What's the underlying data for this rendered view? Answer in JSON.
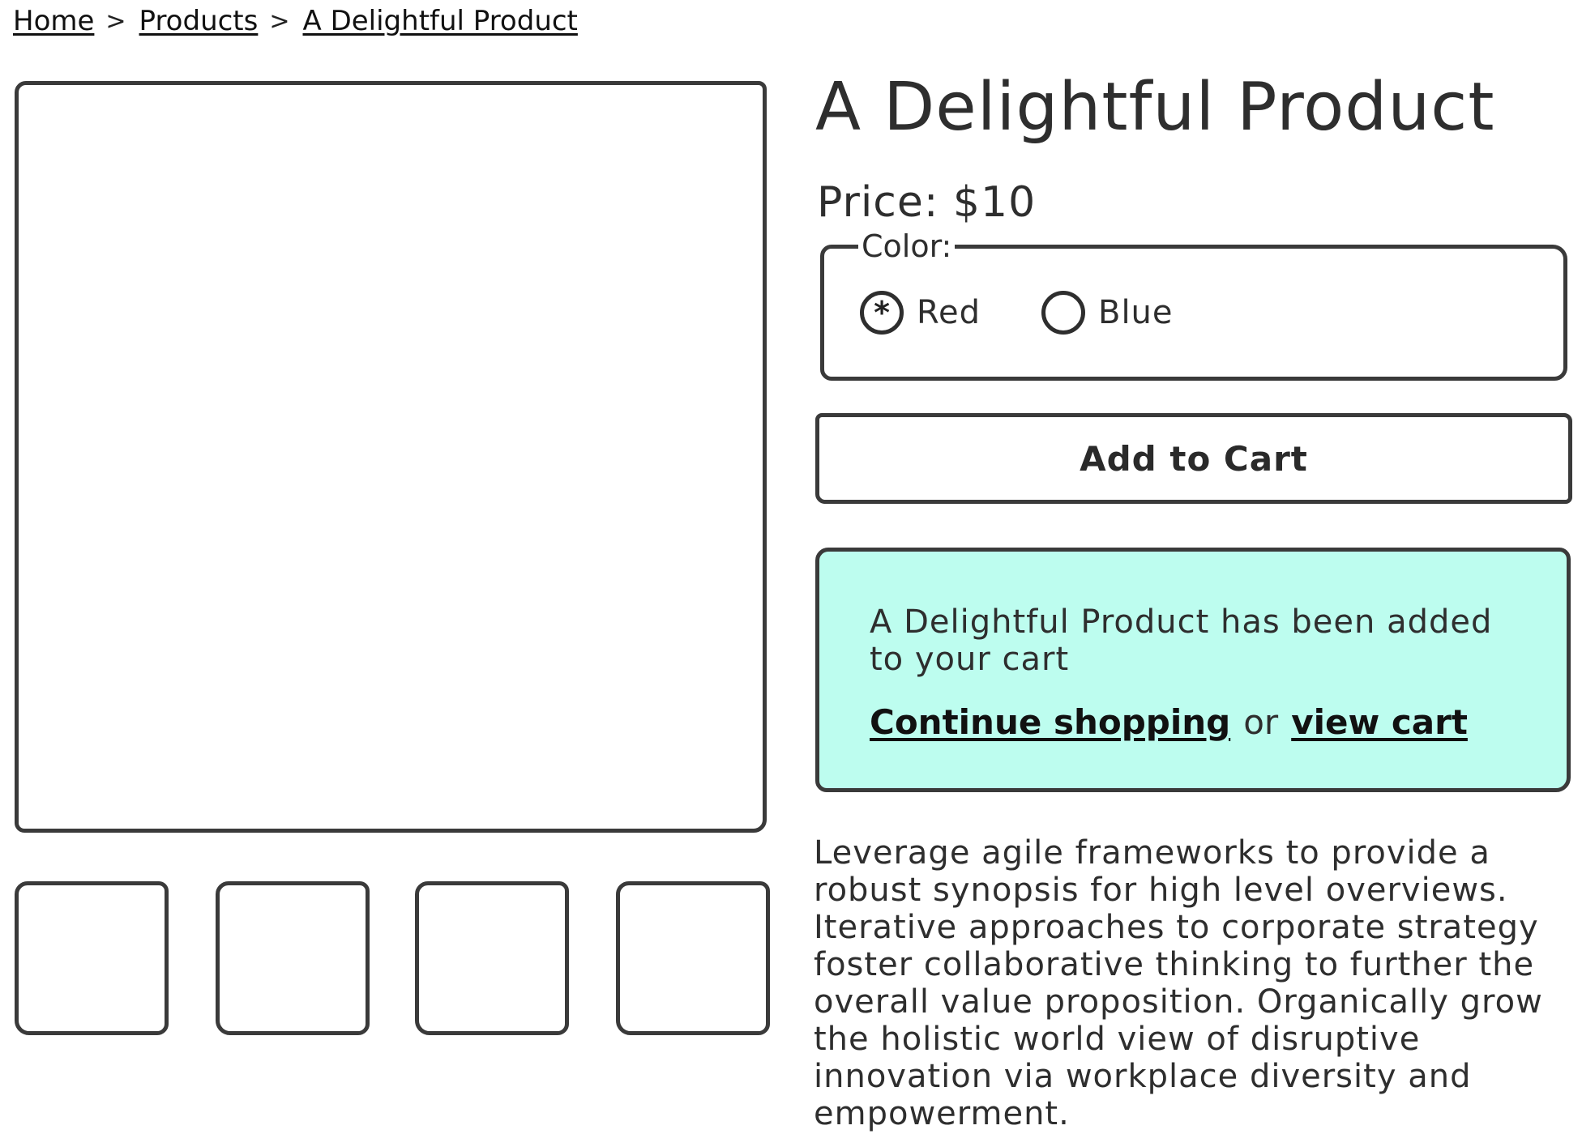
{
  "breadcrumb": {
    "items": [
      {
        "label": "Home"
      },
      {
        "label": "Products"
      },
      {
        "label": "A Delightful Product"
      }
    ],
    "separator": ">"
  },
  "product": {
    "title": "A Delightful Product",
    "price_text": "Price: $10",
    "color_legend": "Color:",
    "color_options": [
      {
        "label": "Red",
        "selected": true,
        "mark": "*"
      },
      {
        "label": "Blue",
        "selected": false,
        "mark": ""
      }
    ],
    "add_to_cart_label": "Add to Cart",
    "description": "Leverage agile frameworks to provide a robust synopsis for high level overviews. Iterative approaches to corporate strategy foster collaborative thinking to further the overall value proposition. Organically grow the holistic world view of disruptive innovation via workplace diversity and empowerment."
  },
  "cart_notice": {
    "message": "A Delightful Product has been added to your cart",
    "continue_label": "Continue shopping",
    "or_text": "or",
    "view_cart_label": "view cart",
    "background_color": "#bdfdef"
  },
  "gallery": {
    "thumbnail_count": 4
  }
}
